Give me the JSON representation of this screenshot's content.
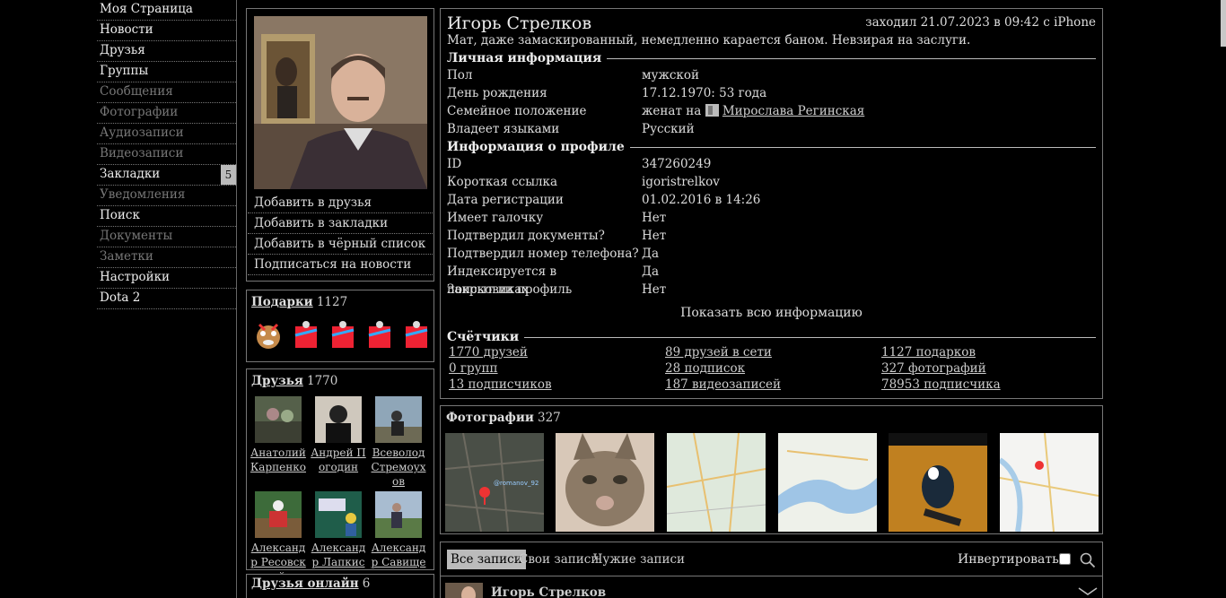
{
  "nav": {
    "items": [
      {
        "label": "Моя Страница",
        "dim": false
      },
      {
        "label": "Новости",
        "dim": false
      },
      {
        "label": "Друзья",
        "dim": false
      },
      {
        "label": "Группы",
        "dim": false
      },
      {
        "label": "Сообщения",
        "dim": true
      },
      {
        "label": "Фотографии",
        "dim": true
      },
      {
        "label": "Аудиозаписи",
        "dim": true
      },
      {
        "label": "Видеозаписи",
        "dim": true
      },
      {
        "label": "Закладки",
        "dim": false,
        "badge": "5"
      },
      {
        "label": "Уведомления",
        "dim": true
      },
      {
        "label": "Поиск",
        "dim": false
      },
      {
        "label": "Документы",
        "dim": true
      },
      {
        "label": "Заметки",
        "dim": true
      },
      {
        "label": "Настройки",
        "dim": false
      },
      {
        "label": "Dota 2",
        "dim": false
      }
    ]
  },
  "actions": [
    "Добавить в друзья",
    "Добавить в закладки",
    "Добавить в чёрный список",
    "Подписаться на новости"
  ],
  "gifts": {
    "title": "Подарки",
    "count": "1127"
  },
  "friends": {
    "title": "Друзья",
    "count": "1770",
    "items": [
      {
        "name": "Анатолий Карпенко"
      },
      {
        "name": "Андрей Погодин"
      },
      {
        "name": "Всеволод Стремоухов"
      },
      {
        "name": "Александр Ресовский"
      },
      {
        "name": "Александр Лапкис"
      },
      {
        "name": "Александр Савищенко"
      }
    ]
  },
  "online": {
    "title": "Друзья онлайн",
    "count": "6"
  },
  "profile": {
    "name": "Игорь Стрелков",
    "last_seen": "заходил 21.07.2023 в 09:42 с iPhone",
    "status": "Мат, даже замаскированный, немедленно карается баном. Невзирая на заслуги.",
    "personal_title": "Личная информация",
    "personal": [
      {
        "label": "Пол",
        "value": "мужской"
      },
      {
        "label": "День рождения",
        "value": "17.12.1970: 53 года"
      },
      {
        "label": "Семейное положение",
        "value": "женат на",
        "link": "Мирослава Регинская"
      },
      {
        "label": "Владеет языками",
        "value": "Русский"
      }
    ],
    "profile_title": "Информация о профиле",
    "profile_info": [
      {
        "label": "ID",
        "value": "347260249"
      },
      {
        "label": "Короткая ссылка",
        "value": "igoristrelkov"
      },
      {
        "label": "Дата регистрации",
        "value": "01.02.2016 в 14:26"
      },
      {
        "label": "Имеет галочку",
        "value": "Нет"
      },
      {
        "label": "Подтвердил документы?",
        "value": "Нет"
      },
      {
        "label": "Подтвердил номер телефона?",
        "value": "Да"
      },
      {
        "label": "Индексируется в поисковиках",
        "value": "Да"
      },
      {
        "label": "Закрыт ли профиль",
        "value": "Нет"
      }
    ],
    "show_all": "Показать всю информацию",
    "counters_title": "Счётчики",
    "counters": [
      [
        "1770 друзей",
        "89 друзей в сети",
        "1127 подарков"
      ],
      [
        "0 групп",
        "28 подписок",
        "327 фотографий"
      ],
      [
        "13 подписчиков",
        "187 видеозаписей",
        "78953 подписчика"
      ]
    ]
  },
  "photos": {
    "title": "Фотографии",
    "count": "327",
    "map_tag": "@romanov_92"
  },
  "wall": {
    "tabs": [
      "Все записи",
      "Свои записи",
      "Чужие записи"
    ],
    "invert": "Инвертировать",
    "post_author": "Игорь Стрелков"
  }
}
